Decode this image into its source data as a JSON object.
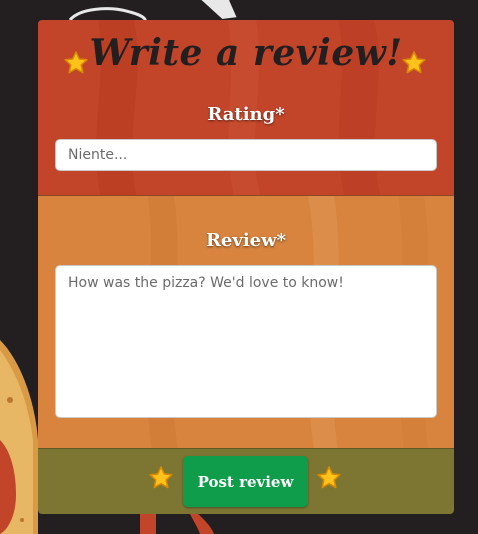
{
  "form": {
    "title": "Write a review!",
    "rating_label": "Rating*",
    "rating_placeholder": "Niente...",
    "review_label": "Review*",
    "review_placeholder": "How was the pizza? We'd love to know!",
    "submit_label": "Post review"
  },
  "icons": [
    "star-icon"
  ],
  "colors": {
    "page_bg": "#231f20",
    "header_section": "#c2452a",
    "body_section": "#d8843f",
    "footer_section": "#7d7632",
    "button": "#0f9c4b",
    "star": "#ffc21a"
  }
}
